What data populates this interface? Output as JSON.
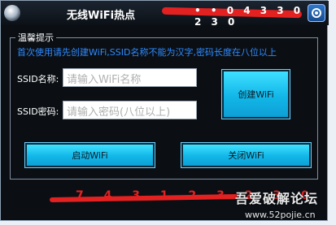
{
  "window": {
    "title": "无线WiFi热点",
    "redacted_title_text": "• • 0 4 3 3 0 3 2 3 0"
  },
  "group": {
    "legend": "温馨提示",
    "notice": "首次使用请先创建WiFi,SSID名称不能为汉字,密码长度在八位以上"
  },
  "form": {
    "ssid_label": "SSID名称:",
    "ssid_placeholder": "请输入WiFi名称",
    "password_label": "SSID密码:",
    "password_placeholder": "请输入密码(八位以上)"
  },
  "buttons": {
    "create": "创建WiFi",
    "start": "启动WiFi",
    "stop": "关闭WiFi"
  },
  "footer": {
    "redacted_text": "7 4 3 1 2 3 2 3 0",
    "watermark": "吾爱破解论坛",
    "watermark_url": "www.52pojie.cn"
  },
  "colors": {
    "background": "#0b0f14",
    "notice": "#2e8bff",
    "button": "#12b7e8",
    "redaction": "#e32121"
  },
  "icons": {
    "app": "app-icon",
    "settings": "gear-icon"
  }
}
